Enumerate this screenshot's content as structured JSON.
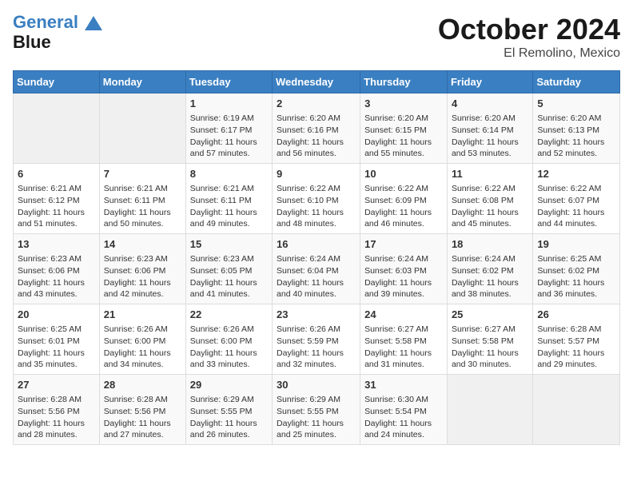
{
  "header": {
    "logo_line1": "General",
    "logo_line2": "Blue",
    "month": "October 2024",
    "location": "El Remolino, Mexico"
  },
  "days_of_week": [
    "Sunday",
    "Monday",
    "Tuesday",
    "Wednesday",
    "Thursday",
    "Friday",
    "Saturday"
  ],
  "weeks": [
    [
      {
        "day": "",
        "sunrise": "",
        "sunset": "",
        "daylight": "",
        "empty": true
      },
      {
        "day": "",
        "sunrise": "",
        "sunset": "",
        "daylight": "",
        "empty": true
      },
      {
        "day": "1",
        "sunrise": "Sunrise: 6:19 AM",
        "sunset": "Sunset: 6:17 PM",
        "daylight": "Daylight: 11 hours and 57 minutes."
      },
      {
        "day": "2",
        "sunrise": "Sunrise: 6:20 AM",
        "sunset": "Sunset: 6:16 PM",
        "daylight": "Daylight: 11 hours and 56 minutes."
      },
      {
        "day": "3",
        "sunrise": "Sunrise: 6:20 AM",
        "sunset": "Sunset: 6:15 PM",
        "daylight": "Daylight: 11 hours and 55 minutes."
      },
      {
        "day": "4",
        "sunrise": "Sunrise: 6:20 AM",
        "sunset": "Sunset: 6:14 PM",
        "daylight": "Daylight: 11 hours and 53 minutes."
      },
      {
        "day": "5",
        "sunrise": "Sunrise: 6:20 AM",
        "sunset": "Sunset: 6:13 PM",
        "daylight": "Daylight: 11 hours and 52 minutes."
      }
    ],
    [
      {
        "day": "6",
        "sunrise": "Sunrise: 6:21 AM",
        "sunset": "Sunset: 6:12 PM",
        "daylight": "Daylight: 11 hours and 51 minutes."
      },
      {
        "day": "7",
        "sunrise": "Sunrise: 6:21 AM",
        "sunset": "Sunset: 6:11 PM",
        "daylight": "Daylight: 11 hours and 50 minutes."
      },
      {
        "day": "8",
        "sunrise": "Sunrise: 6:21 AM",
        "sunset": "Sunset: 6:11 PM",
        "daylight": "Daylight: 11 hours and 49 minutes."
      },
      {
        "day": "9",
        "sunrise": "Sunrise: 6:22 AM",
        "sunset": "Sunset: 6:10 PM",
        "daylight": "Daylight: 11 hours and 48 minutes."
      },
      {
        "day": "10",
        "sunrise": "Sunrise: 6:22 AM",
        "sunset": "Sunset: 6:09 PM",
        "daylight": "Daylight: 11 hours and 46 minutes."
      },
      {
        "day": "11",
        "sunrise": "Sunrise: 6:22 AM",
        "sunset": "Sunset: 6:08 PM",
        "daylight": "Daylight: 11 hours and 45 minutes."
      },
      {
        "day": "12",
        "sunrise": "Sunrise: 6:22 AM",
        "sunset": "Sunset: 6:07 PM",
        "daylight": "Daylight: 11 hours and 44 minutes."
      }
    ],
    [
      {
        "day": "13",
        "sunrise": "Sunrise: 6:23 AM",
        "sunset": "Sunset: 6:06 PM",
        "daylight": "Daylight: 11 hours and 43 minutes."
      },
      {
        "day": "14",
        "sunrise": "Sunrise: 6:23 AM",
        "sunset": "Sunset: 6:06 PM",
        "daylight": "Daylight: 11 hours and 42 minutes."
      },
      {
        "day": "15",
        "sunrise": "Sunrise: 6:23 AM",
        "sunset": "Sunset: 6:05 PM",
        "daylight": "Daylight: 11 hours and 41 minutes."
      },
      {
        "day": "16",
        "sunrise": "Sunrise: 6:24 AM",
        "sunset": "Sunset: 6:04 PM",
        "daylight": "Daylight: 11 hours and 40 minutes."
      },
      {
        "day": "17",
        "sunrise": "Sunrise: 6:24 AM",
        "sunset": "Sunset: 6:03 PM",
        "daylight": "Daylight: 11 hours and 39 minutes."
      },
      {
        "day": "18",
        "sunrise": "Sunrise: 6:24 AM",
        "sunset": "Sunset: 6:02 PM",
        "daylight": "Daylight: 11 hours and 38 minutes."
      },
      {
        "day": "19",
        "sunrise": "Sunrise: 6:25 AM",
        "sunset": "Sunset: 6:02 PM",
        "daylight": "Daylight: 11 hours and 36 minutes."
      }
    ],
    [
      {
        "day": "20",
        "sunrise": "Sunrise: 6:25 AM",
        "sunset": "Sunset: 6:01 PM",
        "daylight": "Daylight: 11 hours and 35 minutes."
      },
      {
        "day": "21",
        "sunrise": "Sunrise: 6:26 AM",
        "sunset": "Sunset: 6:00 PM",
        "daylight": "Daylight: 11 hours and 34 minutes."
      },
      {
        "day": "22",
        "sunrise": "Sunrise: 6:26 AM",
        "sunset": "Sunset: 6:00 PM",
        "daylight": "Daylight: 11 hours and 33 minutes."
      },
      {
        "day": "23",
        "sunrise": "Sunrise: 6:26 AM",
        "sunset": "Sunset: 5:59 PM",
        "daylight": "Daylight: 11 hours and 32 minutes."
      },
      {
        "day": "24",
        "sunrise": "Sunrise: 6:27 AM",
        "sunset": "Sunset: 5:58 PM",
        "daylight": "Daylight: 11 hours and 31 minutes."
      },
      {
        "day": "25",
        "sunrise": "Sunrise: 6:27 AM",
        "sunset": "Sunset: 5:58 PM",
        "daylight": "Daylight: 11 hours and 30 minutes."
      },
      {
        "day": "26",
        "sunrise": "Sunrise: 6:28 AM",
        "sunset": "Sunset: 5:57 PM",
        "daylight": "Daylight: 11 hours and 29 minutes."
      }
    ],
    [
      {
        "day": "27",
        "sunrise": "Sunrise: 6:28 AM",
        "sunset": "Sunset: 5:56 PM",
        "daylight": "Daylight: 11 hours and 28 minutes."
      },
      {
        "day": "28",
        "sunrise": "Sunrise: 6:28 AM",
        "sunset": "Sunset: 5:56 PM",
        "daylight": "Daylight: 11 hours and 27 minutes."
      },
      {
        "day": "29",
        "sunrise": "Sunrise: 6:29 AM",
        "sunset": "Sunset: 5:55 PM",
        "daylight": "Daylight: 11 hours and 26 minutes."
      },
      {
        "day": "30",
        "sunrise": "Sunrise: 6:29 AM",
        "sunset": "Sunset: 5:55 PM",
        "daylight": "Daylight: 11 hours and 25 minutes."
      },
      {
        "day": "31",
        "sunrise": "Sunrise: 6:30 AM",
        "sunset": "Sunset: 5:54 PM",
        "daylight": "Daylight: 11 hours and 24 minutes."
      },
      {
        "day": "",
        "sunrise": "",
        "sunset": "",
        "daylight": "",
        "empty": true
      },
      {
        "day": "",
        "sunrise": "",
        "sunset": "",
        "daylight": "",
        "empty": true
      }
    ]
  ]
}
